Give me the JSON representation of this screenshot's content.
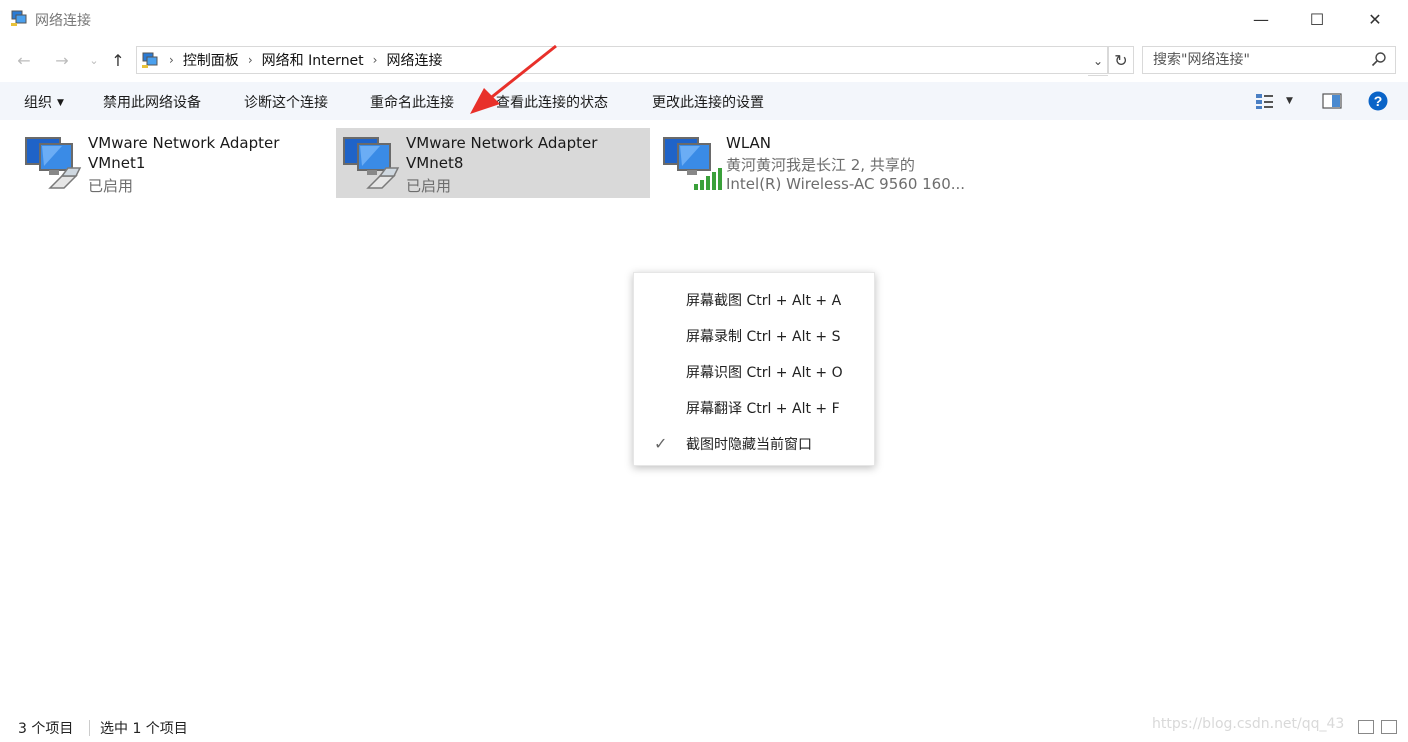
{
  "window": {
    "title": "网络连接",
    "minimize_symbol": "—",
    "maximize_symbol": "☐",
    "close_symbol": "✕"
  },
  "nav": {
    "back_symbol": "←",
    "forward_symbol": "→",
    "recent_symbol": "⌄",
    "up_symbol": "↑",
    "breadcrumbs": [
      "控制面板",
      "网络和 Internet",
      "网络连接"
    ],
    "separator": "›",
    "dropdown_symbol": "⌄",
    "refresh_symbol": "↻",
    "search_placeholder": "搜索\"网络连接\""
  },
  "toolbar": {
    "organize": "组织",
    "disable": "禁用此网络设备",
    "diagnose": "诊断这个连接",
    "rename": "重命名此连接",
    "view_status": "查看此连接的状态",
    "change_settings": "更改此连接的设置"
  },
  "items": [
    {
      "name": "VMware Network Adapter",
      "device": "VMnet1",
      "status": "已启用",
      "selected": false,
      "icon": "ethernet-adapter-icon"
    },
    {
      "name": "VMware Network Adapter",
      "device": "VMnet8",
      "status": "已启用",
      "selected": true,
      "icon": "ethernet-adapter-icon"
    },
    {
      "name": "WLAN",
      "device": "黄河黄河我是长江 2, 共享的",
      "status": "Intel(R) Wireless-AC 9560 160...",
      "selected": false,
      "icon": "wireless-adapter-icon"
    }
  ],
  "context_menu": {
    "items": [
      {
        "label": "屏幕截图 Ctrl + Alt + A",
        "checked": false
      },
      {
        "label": "屏幕录制 Ctrl + Alt + S",
        "checked": false
      },
      {
        "label": "屏幕识图 Ctrl + Alt + O",
        "checked": false
      },
      {
        "label": "屏幕翻译 Ctrl + Alt + F",
        "checked": false
      },
      {
        "label": "截图时隐藏当前窗口",
        "checked": true
      }
    ],
    "check_symbol": "✓"
  },
  "status": {
    "count": "3 个项目",
    "selection": "选中 1 个项目",
    "watermark": "https://blog.csdn.net/qq_43"
  },
  "colors": {
    "accent": "#0a64c8",
    "selection": "#d9d9d9",
    "annotation_arrow": "#e8302a",
    "signal_green": "#3aa03a"
  }
}
